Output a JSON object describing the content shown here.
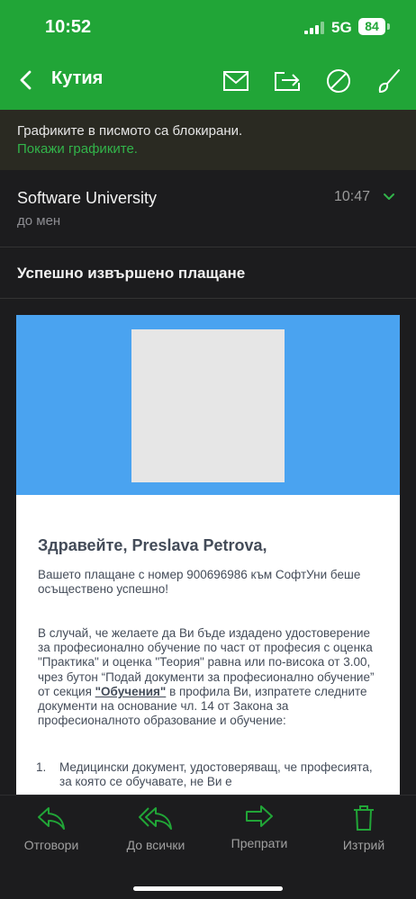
{
  "status": {
    "time": "10:52",
    "network": "5G",
    "battery": "84"
  },
  "nav": {
    "back_label": "Кутия",
    "icons": [
      "mail-icon",
      "move-icon",
      "block-icon",
      "broom-icon"
    ]
  },
  "banner": {
    "text": "Графиките в писмото са блокирани.",
    "link": "Покажи графиките."
  },
  "message": {
    "sender": "Software University",
    "to": "до мен",
    "time": "10:47",
    "subject": "Успешно извършено плащане"
  },
  "email": {
    "greeting": "Здравейте, Preslava Petrova,",
    "p1": "Вашето плащане с номер 900696986 към СофтУни беше осъществено успешно!",
    "p2_before": "В случай, че желаете да Ви бъде издадено удостоверение за професионално обучение по част от професия с оценка \"Практика\" и оценка \"Теория\" равна или по-висока от 3.00, чрез бутон “Подай документи за професионално обучение” от секция ",
    "p2_link": "\"Обучения\"",
    "p2_after": " в профила Ви, изпратете следните документи на основание чл. 14 от Закона за професионалното образование и обучение:",
    "list": [
      {
        "num": "1.",
        "text": "Медицински документ, удостоверяващ, че професията, за която се обучавате, не Ви е"
      }
    ]
  },
  "toolbar": {
    "reply": "Отговори",
    "reply_all": "До всички",
    "forward": "Препрати",
    "delete": "Изтрий"
  },
  "colors": {
    "accent": "#21a537",
    "link": "#32b44a",
    "hero": "#4aa3f0"
  }
}
